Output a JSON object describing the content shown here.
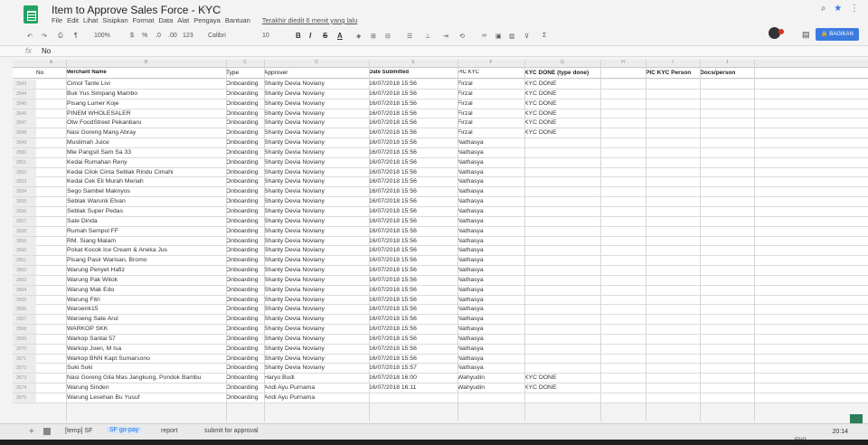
{
  "header": {
    "title": "Item to Approve Sales Force - KYC",
    "menu": [
      "File",
      "Edit",
      "Lihat",
      "Sisipkan",
      "Format",
      "Data",
      "Alat",
      "Pengaya",
      "Bantuan"
    ],
    "last_edit": "Terakhir diedit 6 menit yang lalu",
    "share_label": "BAGIKAN"
  },
  "toolbar": {
    "zoom": "100%",
    "currency": "$",
    "percent": "%",
    "dec_less": ".0",
    "dec_more": ".00",
    "format_more": "123",
    "font": "Calibri",
    "font_size": "10",
    "bold": "B",
    "italic": "I",
    "strike": "S",
    "text_color": "A"
  },
  "formula_bar": {
    "fx": "fx",
    "value": "No"
  },
  "columns": [
    "A",
    "B",
    "C",
    "D",
    "E",
    "F",
    "G",
    "H",
    "I",
    "J"
  ],
  "header_row": {
    "no": "No",
    "merchant": "Merchant Name",
    "type": "Type",
    "approver": "Approver",
    "date": "Date Submitted",
    "pic": "PIC KYC",
    "kyc_done": "KYC DONE (type done)",
    "pic_kyc_person": "PIC KYC Person",
    "docs": "Docs/person"
  },
  "rows": [
    {
      "n": "3543",
      "merchant": "Cimol Tante Livi",
      "type": "Onboarding",
      "approver": "Shanty Devia Noviany",
      "date": "16/07/2018 15:56",
      "pic": "Firzal",
      "kyc": "KYC DONE"
    },
    {
      "n": "3544",
      "merchant": "Buk Yus Simpang Mambo",
      "type": "Onboarding",
      "approver": "Shanty Devia Noviany",
      "date": "16/07/2018 15:56",
      "pic": "Firzal",
      "kyc": "KYC DONE"
    },
    {
      "n": "3545",
      "merchant": "Pisang Lumer Koje",
      "type": "Onboarding",
      "approver": "Shanty Devia Noviany",
      "date": "16/07/2018 15:56",
      "pic": "Firzal",
      "kyc": "KYC DONE"
    },
    {
      "n": "3546",
      "merchant": "PINEM WHOLESALER",
      "type": "Onboarding",
      "approver": "Shanty Devia Noviany",
      "date": "16/07/2018 15:56",
      "pic": "Firzal",
      "kyc": "KYC DONE"
    },
    {
      "n": "3547",
      "merchant": "Otw FoodStreet Pekanbaru",
      "type": "Onboarding",
      "approver": "Shanty Devia Noviany",
      "date": "16/07/2018 15:56",
      "pic": "Firzal",
      "kyc": "KYC DONE"
    },
    {
      "n": "3548",
      "merchant": "Nasi Goreng Mang Abray",
      "type": "Onboarding",
      "approver": "Shanty Devia Noviany",
      "date": "16/07/2018 15:56",
      "pic": "Firzal",
      "kyc": "KYC DONE"
    },
    {
      "n": "3549",
      "merchant": "Muslimah Juice",
      "type": "Onboarding",
      "approver": "Shanty Devia Noviany",
      "date": "16/07/2018 15:56",
      "pic": "Nathasya",
      "kyc": ""
    },
    {
      "n": "3550",
      "merchant": "Mie Pangsit Sam Sa 33",
      "type": "Onboarding",
      "approver": "Shanty Devia Noviany",
      "date": "16/07/2018 15:56",
      "pic": "Nathasya",
      "kyc": ""
    },
    {
      "n": "3551",
      "merchant": "Kedai Rumahan Reny",
      "type": "Onboarding",
      "approver": "Shanty Devia Noviany",
      "date": "16/07/2018 15:56",
      "pic": "Nathasya",
      "kyc": ""
    },
    {
      "n": "3552",
      "merchant": "Kedai Cilok Cinta Seblak Rindu Cimahi",
      "type": "Onboarding",
      "approver": "Shanty Devia Noviany",
      "date": "16/07/2018 15:56",
      "pic": "Nathasya",
      "kyc": ""
    },
    {
      "n": "3553",
      "merchant": "Kedai Cek Eli Murah Meriah",
      "type": "Onboarding",
      "approver": "Shanty Devia Noviany",
      "date": "16/07/2018 15:56",
      "pic": "Nathasya",
      "kyc": ""
    },
    {
      "n": "3554",
      "merchant": "Sego Sambel Maknyos",
      "type": "Onboarding",
      "approver": "Shanty Devia Noviany",
      "date": "16/07/2018 15:56",
      "pic": "Nathasya",
      "kyc": ""
    },
    {
      "n": "3555",
      "merchant": "Seblak Warunk Elvan",
      "type": "Onboarding",
      "approver": "Shanty Devia Noviany",
      "date": "16/07/2018 15:56",
      "pic": "Nathasya",
      "kyc": ""
    },
    {
      "n": "3556",
      "merchant": "Seblak Super Pedas",
      "type": "Onboarding",
      "approver": "Shanty Devia Noviany",
      "date": "16/07/2018 15:56",
      "pic": "Nathasya",
      "kyc": ""
    },
    {
      "n": "3557",
      "merchant": "Sate Dinda",
      "type": "Onboarding",
      "approver": "Shanty Devia Noviany",
      "date": "16/07/2018 15:56",
      "pic": "Nathasya",
      "kyc": ""
    },
    {
      "n": "3558",
      "merchant": "Rumah Sempol FF",
      "type": "Onboarding",
      "approver": "Shanty Devia Noviany",
      "date": "16/07/2018 15:56",
      "pic": "Nathasya",
      "kyc": ""
    },
    {
      "n": "3559",
      "merchant": "RM. Siang Malam",
      "type": "Onboarding",
      "approver": "Shanty Devia Noviany",
      "date": "16/07/2018 15:56",
      "pic": "Nathasya",
      "kyc": ""
    },
    {
      "n": "3560",
      "merchant": "Pokat Kocok Ice Cream & Aneka Jus",
      "type": "Onboarding",
      "approver": "Shanty Devia Noviany",
      "date": "16/07/2018 15:56",
      "pic": "Nathasya",
      "kyc": ""
    },
    {
      "n": "3561",
      "merchant": "Pisang Pasir Warisan, Bromo",
      "type": "Onboarding",
      "approver": "Shanty Devia Noviany",
      "date": "16/07/2018 15:56",
      "pic": "Nathasya",
      "kyc": ""
    },
    {
      "n": "3562",
      "merchant": "Warung Penyet Hafiz",
      "type": "Onboarding",
      "approver": "Shanty Devia Noviany",
      "date": "16/07/2018 15:56",
      "pic": "Nathasya",
      "kyc": ""
    },
    {
      "n": "3563",
      "merchant": "Warung Pak Witok",
      "type": "Onboarding",
      "approver": "Shanty Devia Noviany",
      "date": "16/07/2018 15:56",
      "pic": "Nathasya",
      "kyc": ""
    },
    {
      "n": "3564",
      "merchant": "Warung Mak Edo",
      "type": "Onboarding",
      "approver": "Shanty Devia Noviany",
      "date": "16/07/2018 15:56",
      "pic": "Nathasya",
      "kyc": ""
    },
    {
      "n": "3565",
      "merchant": "Warung Fitri",
      "type": "Onboarding",
      "approver": "Shanty Devia Noviany",
      "date": "16/07/2018 15:56",
      "pic": "Nathasya",
      "kyc": ""
    },
    {
      "n": "3566",
      "merchant": "Waroenk15",
      "type": "Onboarding",
      "approver": "Shanty Devia Noviany",
      "date": "16/07/2018 15:56",
      "pic": "Nathasya",
      "kyc": ""
    },
    {
      "n": "3567",
      "merchant": "Waroeng Sate Arul",
      "type": "Onboarding",
      "approver": "Shanty Devia Noviany",
      "date": "16/07/2018 15:56",
      "pic": "Nathasya",
      "kyc": ""
    },
    {
      "n": "3568",
      "merchant": "WARKOP SKK",
      "type": "Onboarding",
      "approver": "Shanty Devia Noviany",
      "date": "16/07/2018 15:56",
      "pic": "Nathasya",
      "kyc": ""
    },
    {
      "n": "3569",
      "merchant": "Warkop Santai 57",
      "type": "Onboarding",
      "approver": "Shanty Devia Noviany",
      "date": "16/07/2018 15:56",
      "pic": "Nathasya",
      "kyc": ""
    },
    {
      "n": "3570",
      "merchant": "Warkop Joen, M Isa",
      "type": "Onboarding",
      "approver": "Shanty Devia Noviany",
      "date": "16/07/2018 15:56",
      "pic": "Nathasya",
      "kyc": ""
    },
    {
      "n": "3571",
      "merchant": "Warkop BNN Kapt Sumarsono",
      "type": "Onboarding",
      "approver": "Shanty Devia Noviany",
      "date": "16/07/2018 15:56",
      "pic": "Nathasya",
      "kyc": ""
    },
    {
      "n": "3572",
      "merchant": "Suki Suki",
      "type": "Onboarding",
      "approver": "Shanty Devia Noviany",
      "date": "16/07/2018 15:57",
      "pic": "Nathasya",
      "kyc": ""
    },
    {
      "n": "3573",
      "merchant": "Nasi Goreng Gila Mas Jangkung, Pondok Bambu",
      "type": "Onboarding",
      "approver": "Haryo Budi",
      "date": "16/07/2018 16:00",
      "pic": "Wahyudin",
      "kyc": "KYC DONE"
    },
    {
      "n": "3574",
      "merchant": "Warung Sinden",
      "type": "Onboarding",
      "approver": "Andi Ayu Purnama",
      "date": "16/07/2018 16:11",
      "pic": "Wahyudin",
      "kyc": "KYC DONE"
    },
    {
      "n": "3575",
      "merchant": "Warung Lesehan Bu Yusuf",
      "type": "Onboarding",
      "approver": "Andi Ayu Purnama",
      "date": "",
      "pic": "",
      "kyc": ""
    }
  ],
  "sheet_tabs": [
    "[temp] SF",
    "SF go-pay",
    "report",
    "submit for approval"
  ],
  "active_tab": "SF go-pay",
  "system": {
    "clock": "20:14",
    "lang": "ENG"
  }
}
